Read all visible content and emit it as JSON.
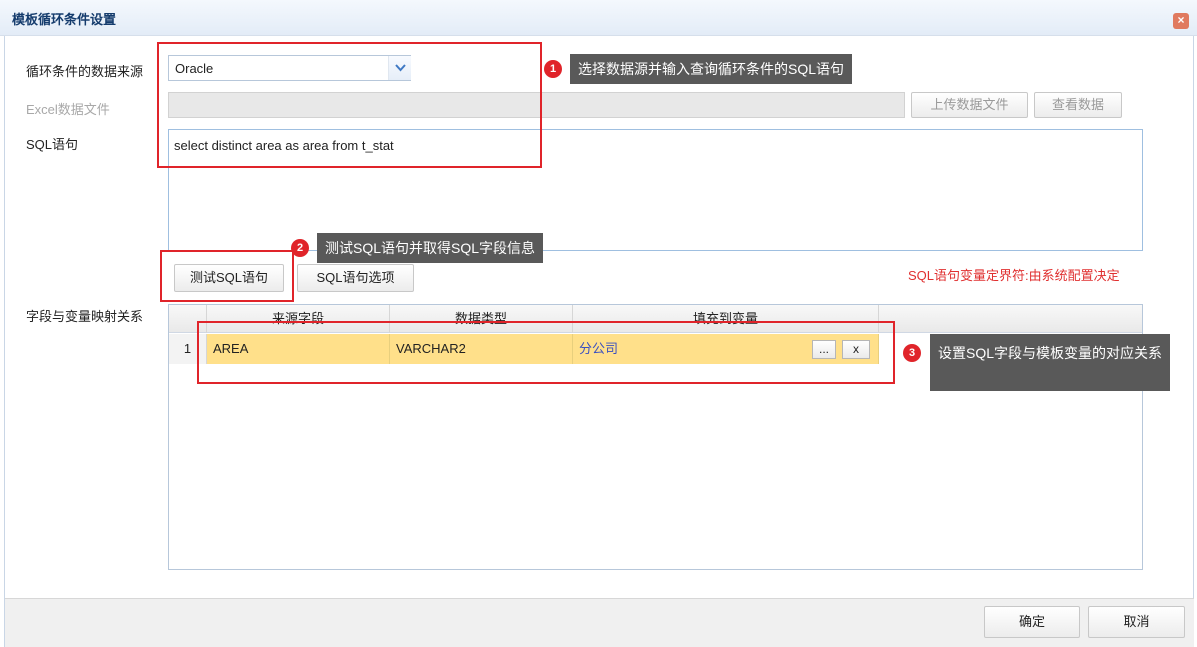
{
  "window": {
    "title": "模板循环条件设置",
    "close_icon": "close-icon"
  },
  "form": {
    "datasource_label": "循环条件的数据来源",
    "datasource_value": "Oracle",
    "excel_label": "Excel数据文件",
    "upload_button": "上传数据文件",
    "view_button": "查看数据",
    "sql_label": "SQL语句",
    "sql_value": "select distinct area as area from t_stat",
    "test_sql_button": "测试SQL语句",
    "sql_options_button": "SQL语句选项",
    "delimiter_note": "SQL语句变量定界符:由系统配置决定",
    "mapping_label": "字段与变量映射关系"
  },
  "grid": {
    "columns": [
      "来源字段",
      "数据类型",
      "填充到变量"
    ],
    "rows": [
      {
        "num": "1",
        "source": "AREA",
        "type": "VARCHAR2",
        "variable": "分公司",
        "browse": "...",
        "clear": "x"
      }
    ]
  },
  "footer": {
    "ok_button": "确定",
    "cancel_button": "取消"
  },
  "annotations": [
    {
      "num": "1",
      "text": "选择数据源并输入查询循环条件的SQL语句"
    },
    {
      "num": "2",
      "text": "测试SQL语句并取得SQL字段信息"
    },
    {
      "num": "3",
      "text": "设置SQL字段与模板变量的对应关系"
    }
  ],
  "colors": {
    "annotation_red": "#e0242a",
    "row_highlight": "#ffe08a",
    "note_red": "#e03030"
  }
}
